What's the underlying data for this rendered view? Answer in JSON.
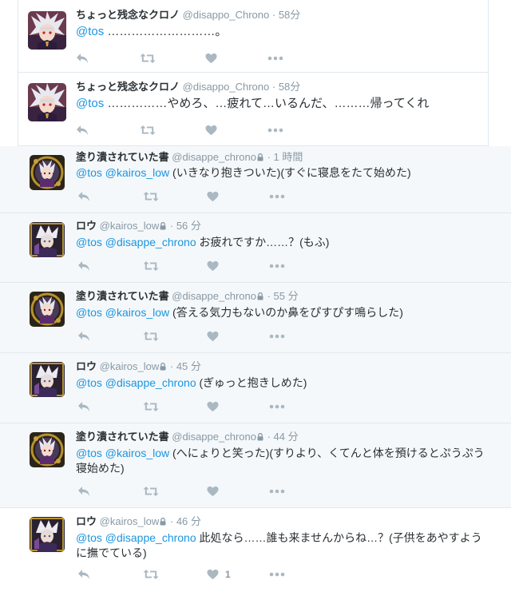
{
  "tweets": [
    {
      "name": "ちょっと残念なクロノ",
      "handle": "@disappo_Chrono",
      "time": "· 58分",
      "mentions": "@tos",
      "text": " ………………………。",
      "locked": false,
      "like_count": ""
    },
    {
      "name": "ちょっと残念なクロノ",
      "handle": "@disappo_Chrono",
      "time": "· 58分",
      "mentions": "@tos",
      "text": " ……………やめろ、…疲れて…いるんだ、………帰ってくれ",
      "locked": false,
      "like_count": ""
    },
    {
      "name": "塗り潰されていた書",
      "handle": "@disappe_chrono",
      "time": "· 1 時間",
      "mentions": "@tos @kairos_low",
      "text": " (いきなり抱きついた)(すぐに寝息をたて始めた)",
      "locked": true,
      "like_count": ""
    },
    {
      "name": "ロウ",
      "handle": "@kairos_low",
      "time": "· 56 分",
      "mentions": "@tos @disappe_chrono",
      "text": " お疲れですか……？(もふ)",
      "locked": true,
      "like_count": ""
    },
    {
      "name": "塗り潰されていた書",
      "handle": "@disappe_chrono",
      "time": "· 55 分",
      "mentions": "@tos @kairos_low",
      "text": " (答える気力もないのか鼻をぴすぴす鳴らした)",
      "locked": true,
      "like_count": ""
    },
    {
      "name": "ロウ",
      "handle": "@kairos_low",
      "time": "· 45 分",
      "mentions": "@tos @disappe_chrono",
      "text": " (ぎゅっと抱きしめた)",
      "locked": true,
      "like_count": ""
    },
    {
      "name": "塗り潰されていた書",
      "handle": "@disappe_chrono",
      "time": "· 44 分",
      "mentions": "@tos @kairos_low",
      "text": " (へにょりと笑った)(すりより、くてんと体を預けるとぷうぷう寝始めた)",
      "locked": true,
      "like_count": ""
    },
    {
      "name": "ロウ",
      "handle": "@kairos_low",
      "time": "· 46 分",
      "mentions": "@tos @disappe_chrono",
      "text": " 此処なら……誰も来ませんからね…？(子供をあやすように撫でている)",
      "locked": true,
      "like_count": "1"
    }
  ],
  "colors": {
    "mention": "#1b95e0",
    "meta": "#8899a6",
    "icon": "#aab8c2",
    "conversation_bg": "#f5f8fa"
  },
  "icons": [
    "reply-icon",
    "retweet-icon",
    "like-icon",
    "more-icon",
    "lock-icon"
  ]
}
